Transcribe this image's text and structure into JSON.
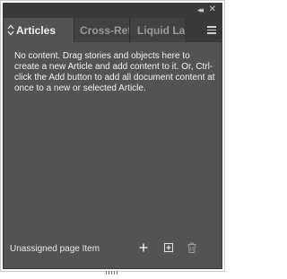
{
  "panel": {
    "active_tab": "Articles",
    "tabs": [
      "Cross-Refe",
      "Liquid Lay"
    ],
    "message": "No content. Drag stories and objects here to create a new Article and add content to it. Or, Ctrl-click the Add button to add all document content at once to a new or selected Article.",
    "footer_label": "Unassigned page Item"
  },
  "icons": {
    "collapse": "double-chevron-right-icon",
    "close": "close-icon",
    "menu": "hamburger-menu-icon",
    "sort": "sort-arrows-icon",
    "add": "plus-icon",
    "add_selected": "add-selected-icon",
    "delete": "trash-icon"
  },
  "colors": {
    "panel_bg": "#535353",
    "tabbar_bg": "#393939",
    "text": "#f2f2f2",
    "inactive_tab_text": "#9a9a9a"
  }
}
